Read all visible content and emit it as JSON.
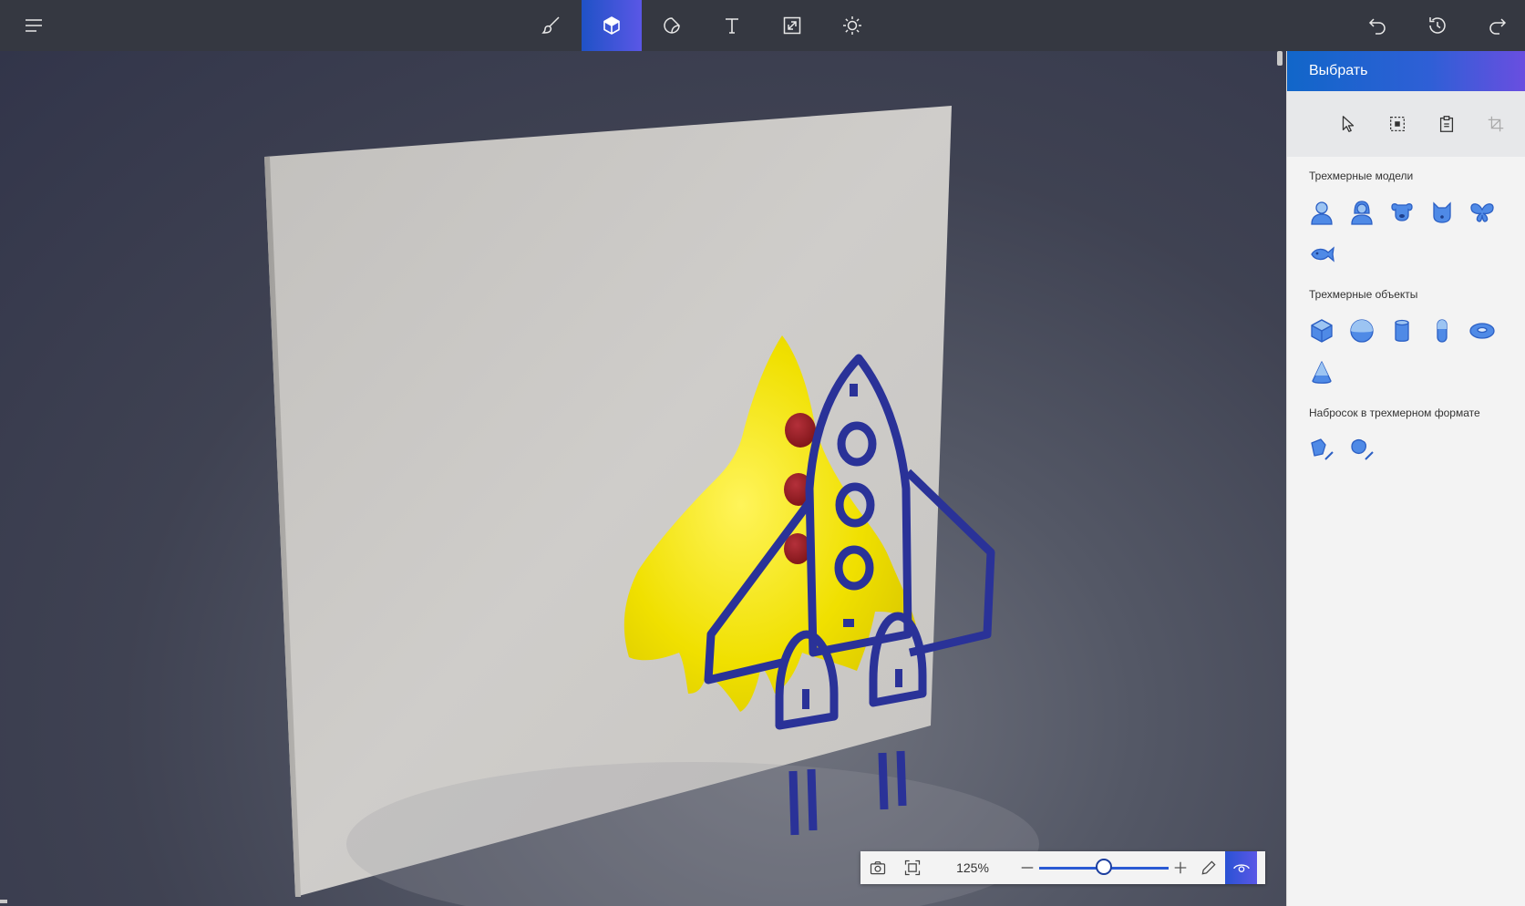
{
  "toolbar": {
    "tools": [
      {
        "name": "brush-tool",
        "icon": "brush-icon"
      },
      {
        "name": "3d-shapes-tool",
        "icon": "cube-icon",
        "active": true
      },
      {
        "name": "stickers-tool",
        "icon": "sticker-icon"
      },
      {
        "name": "text-tool",
        "icon": "text-icon"
      },
      {
        "name": "canvas-tool",
        "icon": "resize-icon"
      },
      {
        "name": "effects-tool",
        "icon": "sun-icon"
      }
    ]
  },
  "panel": {
    "title": "Выбрать",
    "section_models": "Трехмерные модели",
    "section_objects": "Трехмерные объекты",
    "section_doodle": "Набросок в трехмерном формате"
  },
  "zoom": {
    "label": "125%",
    "level": 0.5
  },
  "colors": {
    "accent": "#2f5fd6",
    "rocket_fill": "#f2e300",
    "rocket_outline": "#2a3298",
    "rocket_windows": "#8d1c20"
  }
}
